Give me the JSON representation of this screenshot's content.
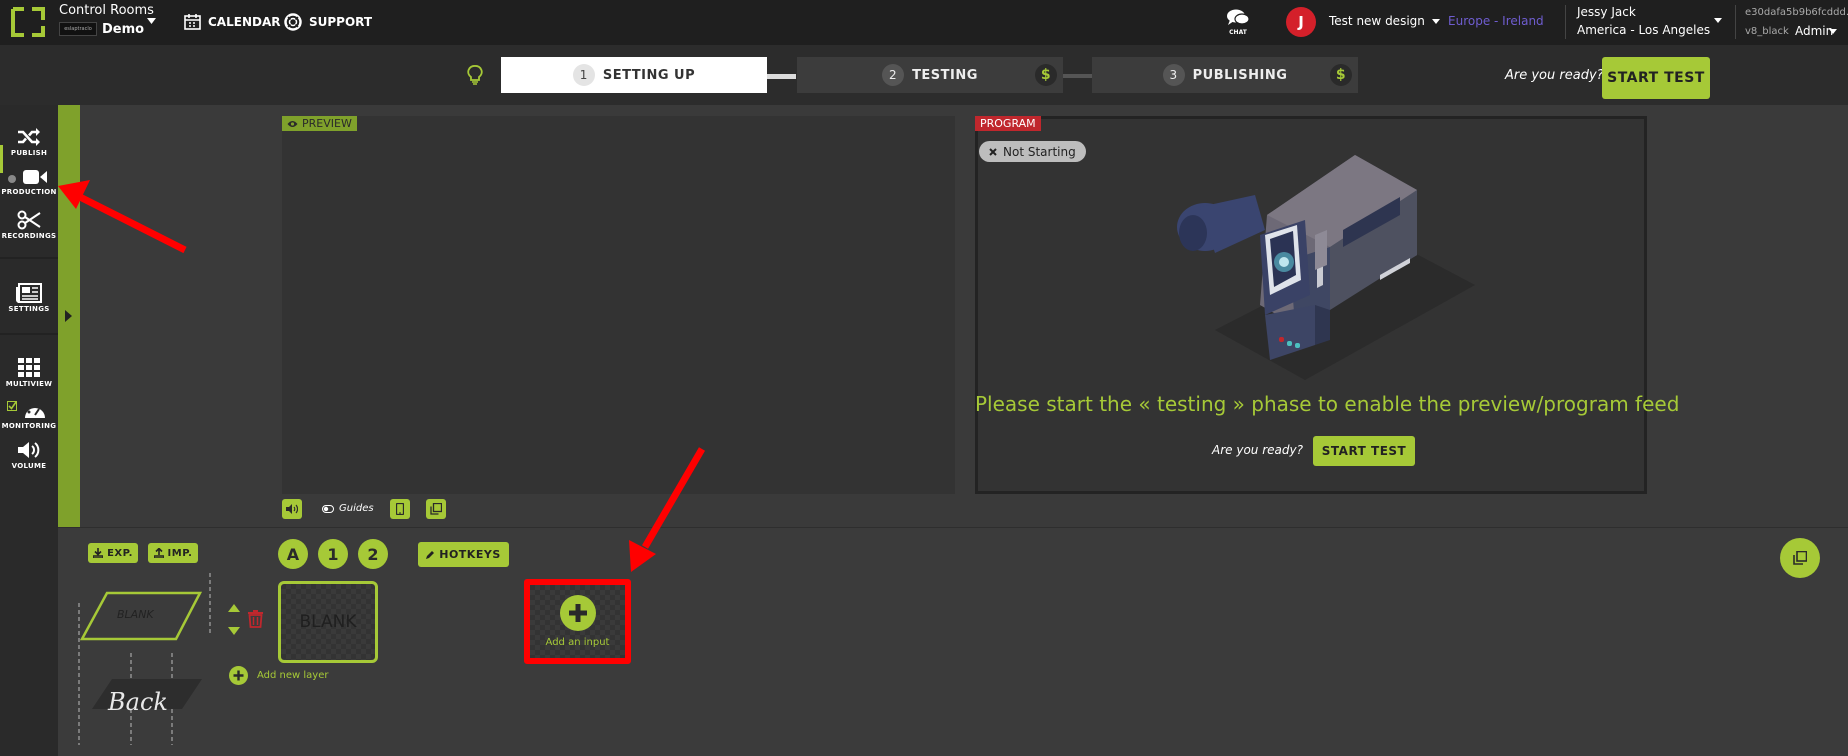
{
  "topbar": {
    "app_title": "Control Rooms",
    "org_logo_text": "eslaptraclo",
    "org_name": "Demo",
    "calendar_label": "CALENDAR",
    "support_label": "SUPPORT",
    "chat_label": "CHAT",
    "user_initial": "J",
    "design_label": "Test new design",
    "region_label": "Europe - Ireland",
    "user_name": "Jessy Jack",
    "timezone": "America - Los Angeles",
    "account_id": "e30dafa5b9b6fcddd...",
    "account_type": "v8_black",
    "role": "Admin"
  },
  "steps": [
    {
      "num": "1",
      "label": "SETTING UP"
    },
    {
      "num": "2",
      "label": "TESTING"
    },
    {
      "num": "3",
      "label": "PUBLISHING"
    }
  ],
  "dollar_symbol": "$",
  "ready_prompt": "Are you ready?",
  "start_test_label": "START TEST",
  "sidebar": {
    "publish": "PUBLISH",
    "production": "PRODUCTION",
    "recordings": "RECORDINGS",
    "settings": "SETTINGS",
    "multiview": "MULTIVIEW",
    "monitoring": "MONITORING",
    "volume": "VOLUME"
  },
  "preview": {
    "tag": "PREVIEW",
    "guides_label": "Guides"
  },
  "program": {
    "tag": "PROGRAM",
    "status": "Not Starting",
    "message": "Please start the « testing » phase to enable the preview/program feed",
    "ready_prompt": "Are you ready?",
    "start_label": "START TEST"
  },
  "bottom": {
    "export_label": "EXP.",
    "import_label": "IMP.",
    "layer_buttons": [
      "A",
      "1",
      "2"
    ],
    "hotkeys_label": "HOTKEYS",
    "blank_label": "BLANK",
    "back_label": "Back",
    "add_layer_label": "Add new layer",
    "add_input_label": "Add an input"
  },
  "colors": {
    "accent": "#a6c937",
    "region": "#6f5dd0",
    "program_tag": "#c0272d",
    "annotation": "#ff0000"
  }
}
